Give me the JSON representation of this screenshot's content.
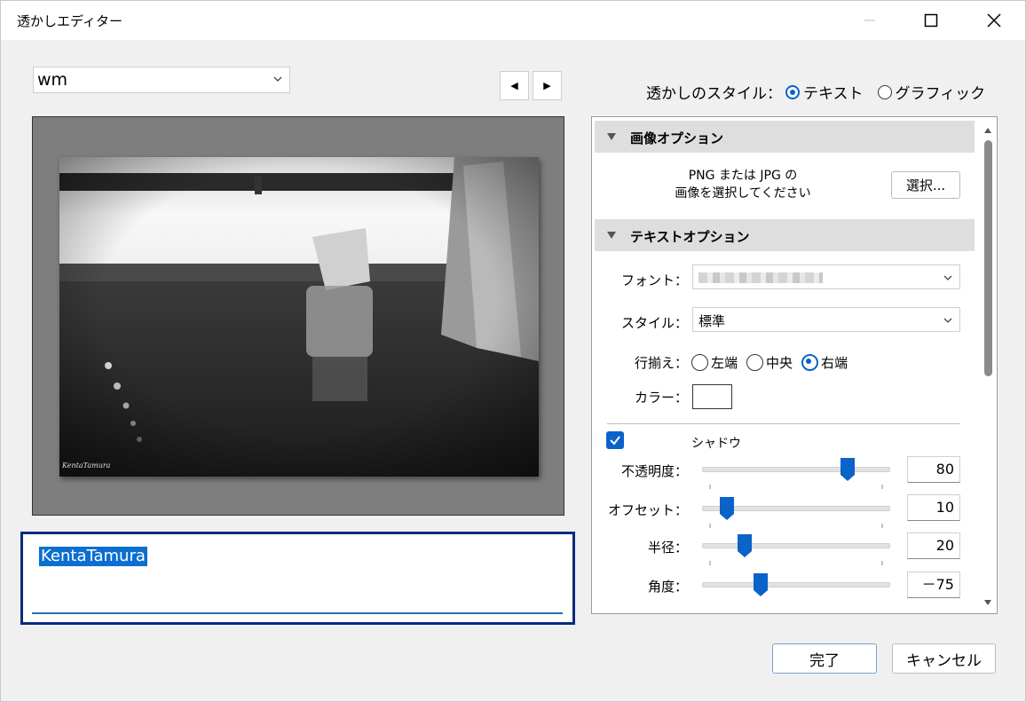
{
  "window": {
    "title": "透かしエディター"
  },
  "preset": {
    "value": "wm"
  },
  "watermark_text": "KentaTamura",
  "watermark_style": {
    "label": "透かしのスタイル：",
    "options": [
      "テキスト",
      "グラフィック"
    ],
    "selected": "テキスト"
  },
  "image_options": {
    "header": "画像オプション",
    "hint_line1": "PNG または JPG の",
    "hint_line2": "画像を選択してください",
    "select_button": "選択..."
  },
  "text_options": {
    "header": "テキストオプション",
    "font_label": "フォント：",
    "style_label": "スタイル：",
    "style_value": "標準",
    "align_label": "行揃え：",
    "align_options": [
      "左端",
      "中央",
      "右端"
    ],
    "align_selected": "右端",
    "color_label": "カラー：",
    "color_value": "#ffffff"
  },
  "shadow": {
    "checkbox_checked": true,
    "label": "シャドウ",
    "opacity": {
      "label": "不透明度：",
      "value": "80"
    },
    "offset": {
      "label": "オフセット：",
      "value": "10"
    },
    "radius": {
      "label": "半径：",
      "value": "20"
    },
    "angle": {
      "label": "角度：",
      "value": "－75"
    }
  },
  "buttons": {
    "ok": "完了",
    "cancel": "キャンセル"
  },
  "colors": {
    "accent": "#0a63c9",
    "focus_border": "#0a2a80"
  }
}
